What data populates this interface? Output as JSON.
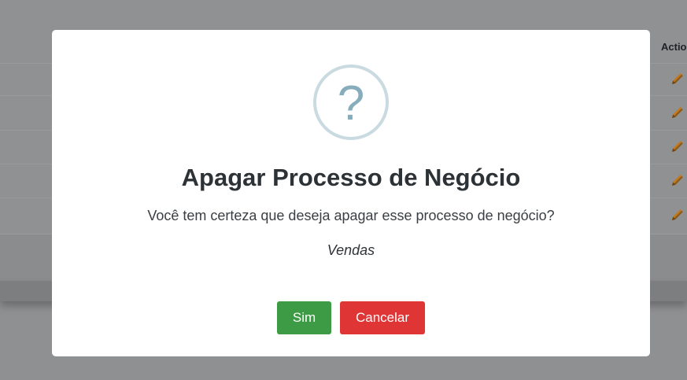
{
  "background": {
    "actions_header": "Actio",
    "edit_rows": [
      {
        "icon": "pencil-icon"
      },
      {
        "icon": "pencil-icon"
      },
      {
        "icon": "pencil-icon"
      },
      {
        "icon": "pencil-icon"
      },
      {
        "icon": "pencil-icon"
      }
    ]
  },
  "modal": {
    "icon": "question-mark-icon",
    "icon_glyph": "?",
    "title": "Apagar Processo de Negócio",
    "message": "Você tem certeza que deseja apagar esse processo de negócio?",
    "item_name": "Vendas",
    "confirm_label": "Sim",
    "cancel_label": "Cancelar"
  },
  "colors": {
    "confirm": "#3d9b45",
    "cancel": "#e03535",
    "icon_ring": "#c9dae1",
    "icon_glyph": "#87adbd",
    "edit_icon": "#e08a1e"
  }
}
